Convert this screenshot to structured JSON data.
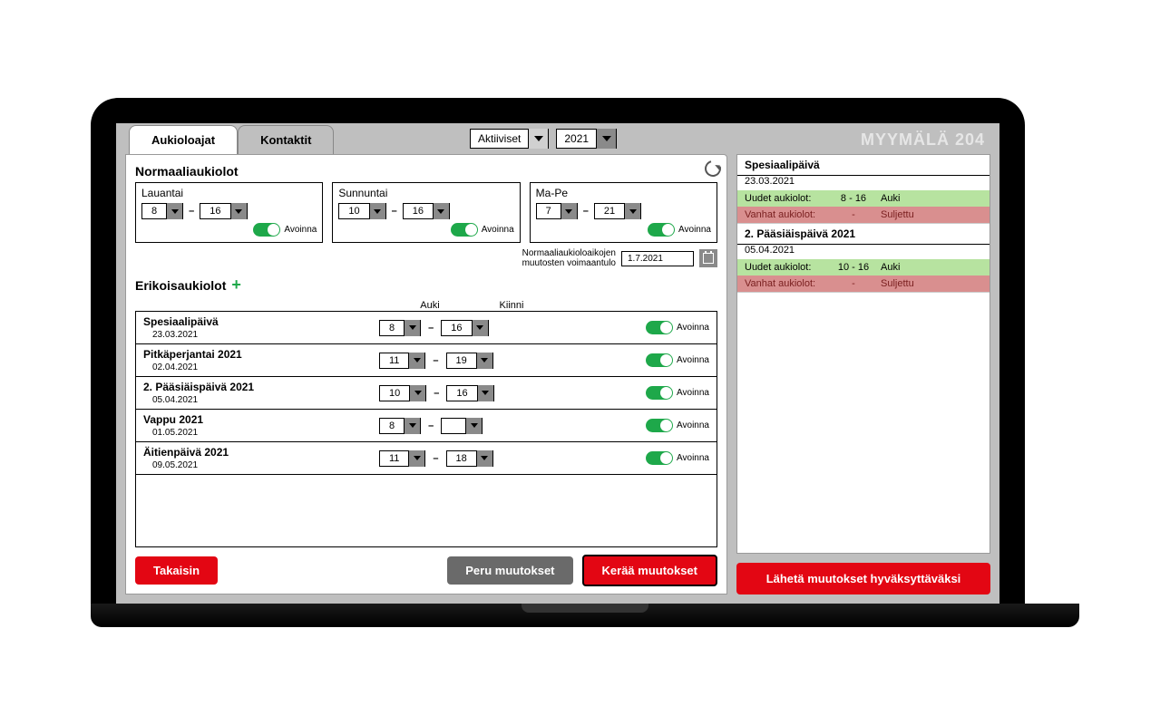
{
  "header": {
    "tabs": [
      "Aukioloajat",
      "Kontaktit"
    ],
    "filter": "Aktiiviset",
    "year": "2021",
    "store": "MYYMÄLÄ 204"
  },
  "normal": {
    "title": "Normaaliaukiolot",
    "days": [
      {
        "name": "Lauantai",
        "open": "8",
        "close": "16",
        "status": "Avoinna"
      },
      {
        "name": "Sunnuntai",
        "open": "10",
        "close": "16",
        "status": "Avoinna"
      },
      {
        "name": "Ma-Pe",
        "open": "7",
        "close": "21",
        "status": "Avoinna"
      }
    ],
    "effective_label_l1": "Normaaliaukioloaikojen",
    "effective_label_l2": "muutosten voimaantulo",
    "effective_date": "1.7.2021"
  },
  "special": {
    "title": "Erikoisaukiolot",
    "col_open": "Auki",
    "col_close": "Kiinni",
    "rows": [
      {
        "name": "Spesiaalipäivä",
        "date": "23.03.2021",
        "open": "8",
        "close": "16",
        "status": "Avoinna"
      },
      {
        "name": "Pitkäperjantai 2021",
        "date": "02.04.2021",
        "open": "11",
        "close": "19",
        "status": "Avoinna"
      },
      {
        "name": "2. Pääsiäispäivä 2021",
        "date": "05.04.2021",
        "open": "10",
        "close": "16",
        "status": "Avoinna"
      },
      {
        "name": "Vappu 2021",
        "date": "01.05.2021",
        "open": "8",
        "close": "",
        "status": "Avoinna",
        "close_hatched": true
      },
      {
        "name": "Äitienpäivä 2021",
        "date": "09.05.2021",
        "open": "11",
        "close": "18",
        "status": "Avoinna"
      }
    ]
  },
  "buttons": {
    "back": "Takaisin",
    "cancel": "Peru muutokset",
    "collect": "Kerää muutokset",
    "send": "Lähetä muutokset hyväksyttäväksi"
  },
  "side": [
    {
      "title": "Spesiaalipäivä",
      "date": "23.03.2021",
      "new_label": "Uudet aukiolot:",
      "new_hours": "8 - 16",
      "new_status": "Auki",
      "old_label": "Vanhat aukiolot:",
      "old_hours": "-",
      "old_status": "Suljettu"
    },
    {
      "title": "2. Pääsiäispäivä 2021",
      "date": "05.04.2021",
      "new_label": "Uudet aukiolot:",
      "new_hours": "10 - 16",
      "new_status": "Auki",
      "old_label": "Vanhat aukiolot:",
      "old_hours": "-",
      "old_status": "Suljettu"
    }
  ]
}
